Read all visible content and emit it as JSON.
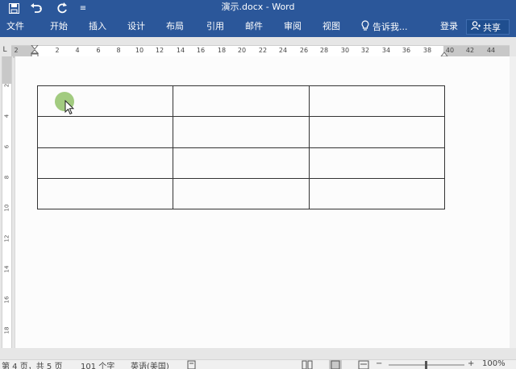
{
  "title_bar": {
    "doc_title": "演示.docx - Word",
    "qat_more": "≡"
  },
  "ribbon": {
    "tabs": [
      "文件",
      "开始",
      "插入",
      "设计",
      "布局",
      "引用",
      "邮件",
      "审阅",
      "视图"
    ],
    "tell_me": "告诉我...",
    "sign_in": "登录",
    "share": "共享"
  },
  "ruler": {
    "corner": "L",
    "h_ticks": [
      "2",
      "2",
      "4",
      "6",
      "8",
      "10",
      "12",
      "14",
      "16",
      "18",
      "20",
      "22",
      "24",
      "26",
      "28",
      "30",
      "32",
      "34",
      "36",
      "38",
      "40",
      "42",
      "44"
    ],
    "v_ticks": [
      "2",
      "4",
      "6",
      "8",
      "10",
      "12",
      "14",
      "16",
      "18"
    ]
  },
  "table": {
    "rows": 4,
    "cols": 3
  },
  "status_bar": {
    "page": "第 4 页，共 5 页",
    "words": "101 个字",
    "language": "英语(美国)",
    "zoom": "100%",
    "zoom_minus": "−",
    "zoom_plus": "+"
  },
  "colors": {
    "accent": "#2b579a",
    "cursor_highlight": "#92c26a"
  }
}
